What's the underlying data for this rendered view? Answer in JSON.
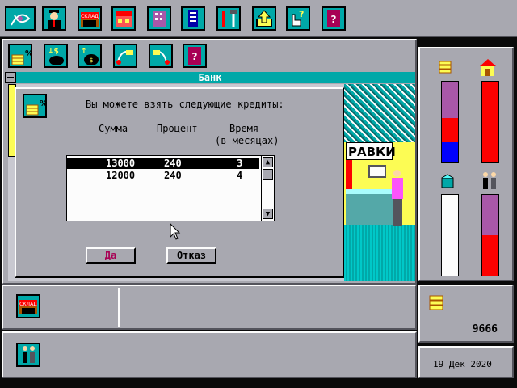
{
  "window": {
    "title": "Банк"
  },
  "dialog": {
    "prompt": "Вы можете взять следующие кредиты:",
    "columns": {
      "amount": "Сумма",
      "percent": "Процент",
      "time": "Время",
      "time_unit": "(в месяцах)"
    },
    "rows": [
      {
        "amount": "13000",
        "percent": "240",
        "months": "3",
        "selected": true
      },
      {
        "amount": "12000",
        "percent": "240",
        "months": "4",
        "selected": false
      }
    ],
    "ok_label": "Да",
    "cancel_label": "Отказ"
  },
  "scene": {
    "sign_text": "РАВКИ"
  },
  "bottom": {
    "store_badge": "СКЛАД"
  },
  "status": {
    "money": "9666",
    "date": "19 Дек 2020"
  },
  "gauges": {
    "money_gauge": [
      {
        "color": "#a858a8",
        "level": 0.45
      },
      {
        "color": "#fc0000",
        "level": 0.3
      },
      {
        "color": "#0000fc",
        "level": 0.25
      }
    ],
    "property_gauge": [
      {
        "color": "#fc0000",
        "level": 1.0
      }
    ],
    "goods_gauge": [
      {
        "color": "#fcfcfc",
        "level": 1.0
      }
    ],
    "staff_gauge": [
      {
        "color": "#a858a8",
        "level": 0.5
      },
      {
        "color": "#fc0000",
        "level": 0.5
      }
    ]
  },
  "colors": {
    "accent": "#00a8a8",
    "panel": "#a8a8b0",
    "title": "#00a8a8"
  }
}
